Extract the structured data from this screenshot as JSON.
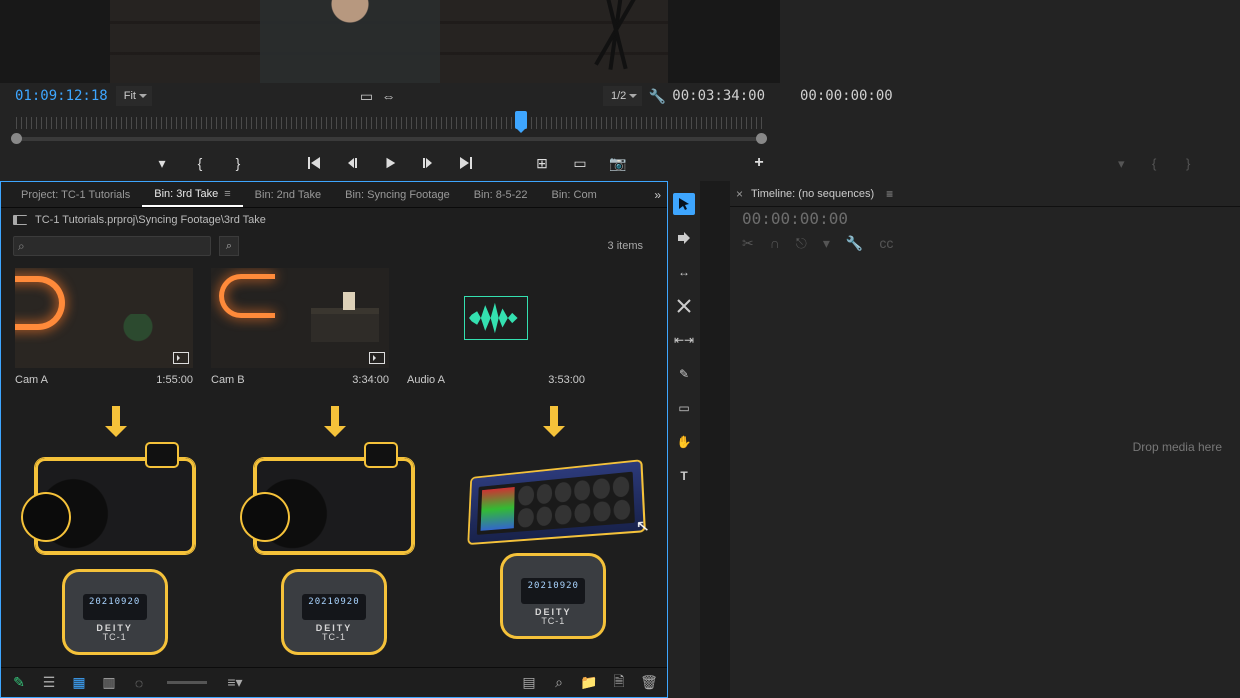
{
  "source_monitor": {
    "timecode": "01:09:12:18",
    "zoom_label": "Fit",
    "res_label": "1/2",
    "duration": "00:03:34:00",
    "playhead_pct": 68
  },
  "program_monitor": {
    "timecode": "00:00:00:00"
  },
  "project": {
    "tabs": [
      {
        "label": "Project: TC-1 Tutorials",
        "active": false
      },
      {
        "label": "Bin: 3rd Take",
        "active": true
      },
      {
        "label": "Bin: 2nd Take",
        "active": false
      },
      {
        "label": "Bin: Syncing Footage",
        "active": false
      },
      {
        "label": "Bin: 8-5-22",
        "active": false
      },
      {
        "label": "Bin: Com",
        "active": false
      }
    ],
    "path": "TC-1 Tutorials.prproj\\Syncing Footage\\3rd Take",
    "item_count_label": "3 items",
    "clips": [
      {
        "name": "Cam A",
        "duration": "1:55:00",
        "type": "video"
      },
      {
        "name": "Cam B",
        "duration": "3:34:00",
        "type": "video"
      },
      {
        "name": "Audio A",
        "duration": "3:53:00",
        "type": "audio"
      }
    ]
  },
  "illustration": {
    "tc_display": "20210920",
    "tc_brand": "DEITY",
    "tc_model": "TC-1"
  },
  "timeline": {
    "title": "Timeline: (no sequences)",
    "timecode": "00:00:00:00",
    "drop_hint": "Drop media here"
  }
}
